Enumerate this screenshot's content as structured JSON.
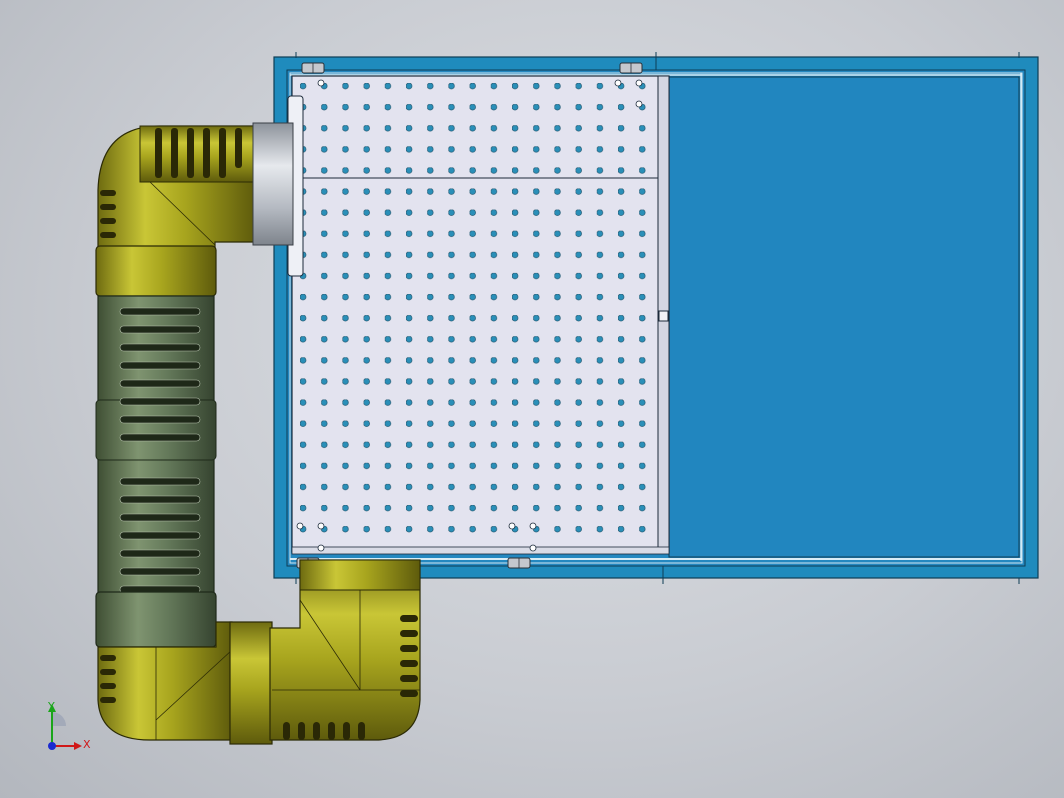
{
  "view": {
    "type": "CAD top view",
    "colors": {
      "background": "#c9ccd2",
      "tank_frame": "#1f8bbd",
      "tank_water": "#2186bf",
      "perforated_plate": "#e3e3ef",
      "plate_hole": "#2a8fb8",
      "pipe_fitting": "#a5a31c",
      "pipe_dark": "#6b6a12",
      "corrugated_hose": "#687d57",
      "metal_flange": "#b9bec6"
    }
  },
  "triad": {
    "y_label": "Y",
    "x_label": "X",
    "icon": "coordinate-triad-icon"
  }
}
